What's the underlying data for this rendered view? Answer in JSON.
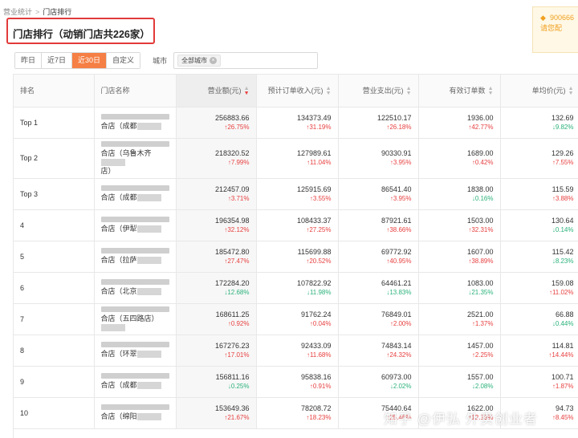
{
  "breadcrumb": {
    "parent": "营业统计",
    "sep": ">",
    "current": "门店排行"
  },
  "notice": {
    "line1": "900666",
    "line2": "请您配"
  },
  "page": {
    "title": "门店排行（动销门店共226家）"
  },
  "filters": {
    "tabs": [
      "昨日",
      "近7日",
      "近30日",
      "自定义"
    ],
    "active_tab": "近30日",
    "city_label": "城市",
    "city_tag": "全部城市"
  },
  "table": {
    "headers": {
      "rank": "排名",
      "store": "门店名称",
      "revenue": "营业额(元)",
      "expected_income": "预计订单收入(元)",
      "expense": "营业支出(元)",
      "orders": "有效订单数",
      "avg_price": "单均价(元)"
    },
    "rows": [
      {
        "rank": "Top 1",
        "store_a": "合店（成都",
        "store_b": "",
        "revenue": "256883.66",
        "revenue_chg": "↑26.75%",
        "income": "134373.49",
        "income_chg": "↑31.19%",
        "expense": "122510.17",
        "expense_chg": "↑26.18%",
        "orders": "1936.00",
        "orders_chg": "↑42.77%",
        "avg": "132.69",
        "avg_chg": "↓9.82%"
      },
      {
        "rank": "Top 2",
        "store_a": "合店（乌鲁木齐",
        "store_b": "店）",
        "revenue": "218320.52",
        "revenue_chg": "↑7.99%",
        "income": "127989.61",
        "income_chg": "↑11.04%",
        "expense": "90330.91",
        "expense_chg": "↑3.95%",
        "orders": "1689.00",
        "orders_chg": "↑0.42%",
        "avg": "129.26",
        "avg_chg": "↑7.55%"
      },
      {
        "rank": "Top 3",
        "store_a": "合店（成都",
        "store_b": "",
        "revenue": "212457.09",
        "revenue_chg": "↑3.71%",
        "income": "125915.69",
        "income_chg": "↑3.55%",
        "expense": "86541.40",
        "expense_chg": "↑3.95%",
        "orders": "1838.00",
        "orders_chg": "↓0.16%",
        "avg": "115.59",
        "avg_chg": "↑3.88%"
      },
      {
        "rank": "4",
        "store_a": "合店（伊犁",
        "store_b": "",
        "revenue": "196354.98",
        "revenue_chg": "↑32.12%",
        "income": "108433.37",
        "income_chg": "↑27.25%",
        "expense": "87921.61",
        "expense_chg": "↑38.66%",
        "orders": "1503.00",
        "orders_chg": "↑32.31%",
        "avg": "130.64",
        "avg_chg": "↓0.14%"
      },
      {
        "rank": "5",
        "store_a": "合店（拉萨",
        "store_b": "",
        "revenue": "185472.80",
        "revenue_chg": "↑27.47%",
        "income": "115699.88",
        "income_chg": "↑20.52%",
        "expense": "69772.92",
        "expense_chg": "↑40.95%",
        "orders": "1607.00",
        "orders_chg": "↑38.89%",
        "avg": "115.42",
        "avg_chg": "↓8.23%"
      },
      {
        "rank": "6",
        "store_a": "合店（北京",
        "store_b": "",
        "revenue": "172284.20",
        "revenue_chg": "↓12.68%",
        "income": "107822.92",
        "income_chg": "↓11.98%",
        "expense": "64461.21",
        "expense_chg": "↓13.83%",
        "orders": "1083.00",
        "orders_chg": "↓21.35%",
        "avg": "159.08",
        "avg_chg": "↑11.02%"
      },
      {
        "rank": "7",
        "store_a": "合店（五四路店）",
        "store_b": "",
        "revenue": "168611.25",
        "revenue_chg": "↑0.92%",
        "income": "91762.24",
        "income_chg": "↑0.04%",
        "expense": "76849.01",
        "expense_chg": "↑2.00%",
        "orders": "2521.00",
        "orders_chg": "↑1.37%",
        "avg": "66.88",
        "avg_chg": "↓0.44%"
      },
      {
        "rank": "8",
        "store_a": "合店（环翠",
        "store_b": "",
        "revenue": "167276.23",
        "revenue_chg": "↑17.01%",
        "income": "92433.09",
        "income_chg": "↑11.68%",
        "expense": "74843.14",
        "expense_chg": "↑24.32%",
        "orders": "1457.00",
        "orders_chg": "↑2.25%",
        "avg": "114.81",
        "avg_chg": "↑14.44%"
      },
      {
        "rank": "9",
        "store_a": "合店（成都",
        "store_b": "",
        "revenue": "156811.16",
        "revenue_chg": "↓0.25%",
        "income": "95838.16",
        "income_chg": "↑0.91%",
        "expense": "60973.00",
        "expense_chg": "↓2.02%",
        "orders": "1557.00",
        "orders_chg": "↓2.08%",
        "avg": "100.71",
        "avg_chg": "↑1.87%"
      },
      {
        "rank": "10",
        "store_a": "合店（绵阳",
        "store_b": "",
        "revenue": "153649.36",
        "revenue_chg": "↑21.67%",
        "income": "78208.72",
        "income_chg": "↑18.23%",
        "expense": "75440.64",
        "expense_chg": "↑25.46%",
        "orders": "1622.00",
        "orders_chg": "↑12.19%",
        "avg": "94.73",
        "avg_chg": "↑8.45%"
      }
    ]
  },
  "watermark": "知乎 @伊弘 外卖创业者"
}
